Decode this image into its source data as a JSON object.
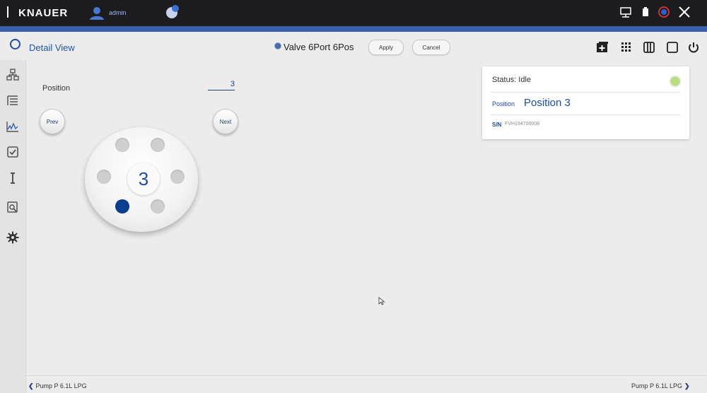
{
  "topbar": {
    "brand": "KNAUER",
    "username": "admin",
    "icons": [
      "user-icon",
      "notification-bell-icon",
      "network-icon",
      "battery-icon",
      "shutdown-status-icon",
      "close-icon"
    ]
  },
  "header": {
    "view_title": "Detail View",
    "device_name": "Valve 6Port 6Pos",
    "apply_label": "Apply",
    "cancel_label": "Cancel",
    "icons": [
      "add-window-icon",
      "grid-icon",
      "columns-icon",
      "single-window-icon",
      "power-icon"
    ]
  },
  "sidebar": {
    "items": [
      "system-icon",
      "method-list-icon",
      "chromatogram-icon",
      "checklist-icon",
      "text-cursor-icon",
      "search-data-icon",
      "settings-gear-icon"
    ]
  },
  "control": {
    "position_label": "Position",
    "position_value": "3",
    "prev_label": "Prev",
    "next_label": "Next",
    "valve_number": "3",
    "active_port": 3
  },
  "status_card": {
    "status_text": "Status: Idle",
    "position_key": "Position",
    "position_value": "Position 3",
    "sn_key": "S/N",
    "sn_value": "FVH194700008",
    "led_color": "#b7e07a"
  },
  "footer": {
    "prev_device": "Pump P 6.1L LPG",
    "next_device": "Pump P 6.1L LPG"
  },
  "colors": {
    "accent": "#1f4ea0",
    "topbar": "#1c1c1e",
    "strip": "#3b5ea8"
  }
}
